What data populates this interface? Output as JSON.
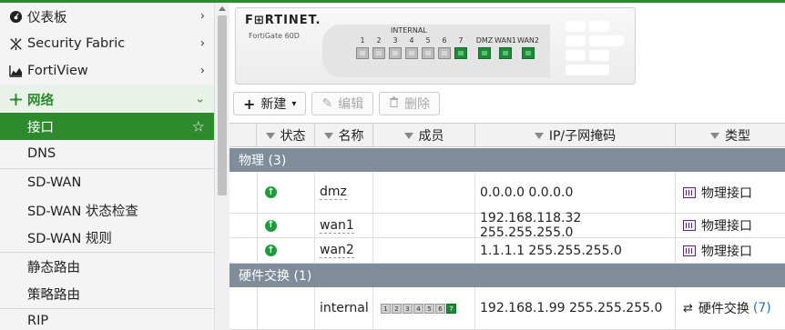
{
  "sidebar": {
    "items": [
      {
        "label": "仪表板",
        "icon": "dashboard-icon"
      },
      {
        "label": "Security Fabric",
        "icon": "fabric-icon"
      },
      {
        "label": "FortiView",
        "icon": "chart-icon"
      },
      {
        "label": "网络",
        "icon": "network-icon"
      },
      {
        "label": "接口"
      },
      {
        "label": "DNS"
      },
      {
        "label": "SD-WAN"
      },
      {
        "label": "SD-WAN 状态检查"
      },
      {
        "label": "SD-WAN 规则"
      },
      {
        "label": "静态路由"
      },
      {
        "label": "策略路由"
      },
      {
        "label": "RIP"
      }
    ]
  },
  "device": {
    "brand": "F⊞RTINET.",
    "model": "FortiGate 60D",
    "internal_label": "INTERNAL",
    "ports": [
      "1",
      "2",
      "3",
      "4",
      "5",
      "6",
      "7",
      "DMZ",
      "WAN1",
      "WAN2"
    ]
  },
  "toolbar": {
    "new_label": "新建",
    "edit_label": "编辑",
    "delete_label": "删除"
  },
  "table": {
    "columns": [
      "状态",
      "名称",
      "成员",
      "IP/子网掩码",
      "类型"
    ],
    "groups": [
      {
        "label": "物理 (3)"
      },
      {
        "label": "硬件交换 (1)"
      }
    ],
    "rows": [
      {
        "status": "up",
        "name": "dmz",
        "members": "",
        "ip": "0.0.0.0 0.0.0.0",
        "type": "物理接口"
      },
      {
        "status": "up",
        "name": "wan1",
        "members": "",
        "ip": "192.168.118.32 255.255.255.0",
        "type": "物理接口"
      },
      {
        "status": "up",
        "name": "wan2",
        "members": "",
        "ip": "1.1.1.1 255.255.255.0",
        "type": "物理接口"
      },
      {
        "status": "",
        "name": "internal",
        "members": [
          "1",
          "2",
          "3",
          "4",
          "5",
          "6",
          "7"
        ],
        "ip": "192.168.1.99 255.255.255.0",
        "type": "硬件交换",
        "type_count": "(7)"
      }
    ]
  },
  "colors": {
    "accent": "#2d8a2d",
    "group_header": "#7f8c99",
    "status_up": "#1f9b3b",
    "port_up": "#1f8a3a"
  }
}
